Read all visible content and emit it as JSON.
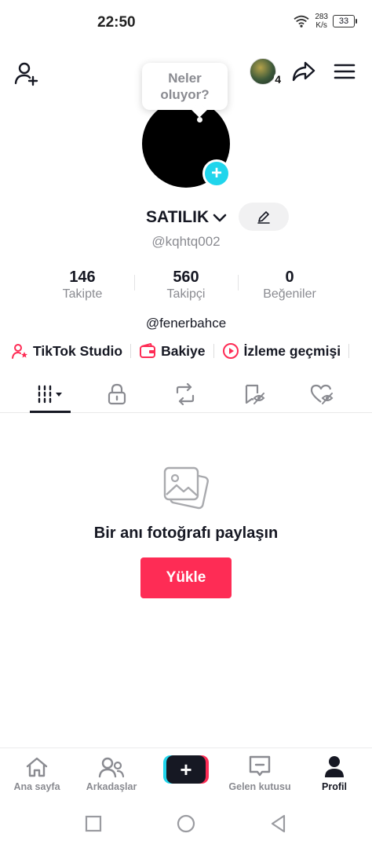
{
  "status_bar": {
    "time": "22:50",
    "net_speed_value": "283",
    "net_speed_unit": "K/s",
    "battery": "33"
  },
  "top_bar": {
    "notifications_count": "4"
  },
  "profile": {
    "tooltip": "Neler oluyor?",
    "display_name": "SATILIK",
    "username": "@kqhtq002",
    "bio": "@fenerbahce",
    "stats": [
      {
        "value": "146",
        "label": "Takipte"
      },
      {
        "value": "560",
        "label": "Takipçi"
      },
      {
        "value": "0",
        "label": "Beğeniler"
      }
    ]
  },
  "shortcuts": [
    {
      "label": "TikTok Studio",
      "icon": "studio-icon"
    },
    {
      "label": "Bakiye",
      "icon": "wallet-icon"
    },
    {
      "label": "İzleme geçmişi",
      "icon": "play-history-icon"
    }
  ],
  "tabs": [
    {
      "icon": "grid-videos-icon",
      "active": true
    },
    {
      "icon": "lock-icon",
      "active": false
    },
    {
      "icon": "repost-icon",
      "active": false
    },
    {
      "icon": "saved-icon",
      "active": false
    },
    {
      "icon": "liked-hidden-icon",
      "active": false
    }
  ],
  "empty_state": {
    "title": "Bir anı fotoğrafı paylaşın",
    "button": "Yükle"
  },
  "bottom_nav": {
    "home": "Ana sayfa",
    "friends": "Arkadaşlar",
    "inbox": "Gelen kutusu",
    "profile": "Profil"
  },
  "colors": {
    "accent": "#fe2c55",
    "cyan": "#20d5ec",
    "text": "#161823",
    "muted": "#8a8b91"
  }
}
